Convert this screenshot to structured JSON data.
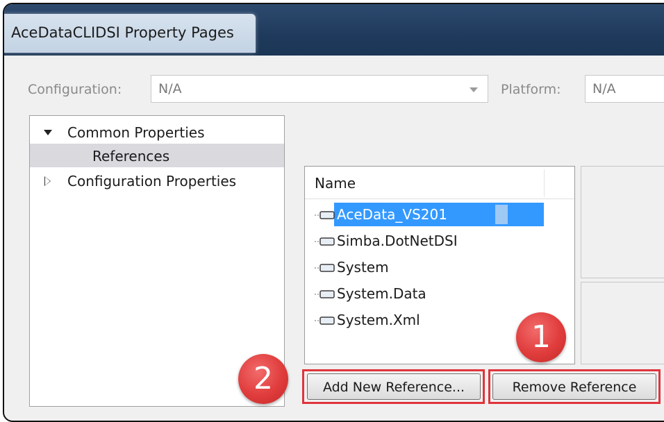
{
  "window": {
    "title": "AceDataCLIDSI Property Pages"
  },
  "config_bar": {
    "configuration_label": "Configuration:",
    "configuration_value": "N/A",
    "platform_label": "Platform:",
    "platform_value": "N/A"
  },
  "tree": {
    "items": [
      {
        "label": "Common Properties",
        "expanded": true
      },
      {
        "label": "References",
        "selected": true
      },
      {
        "label": "Configuration Properties",
        "expanded": false
      }
    ]
  },
  "references": {
    "column_header": "Name",
    "rows": [
      {
        "name": "AceData_VS201",
        "selected": true
      },
      {
        "name": "Simba.DotNetDSI"
      },
      {
        "name": "System"
      },
      {
        "name": "System.Data"
      },
      {
        "name": "System.Xml"
      }
    ]
  },
  "buttons": {
    "add_new_reference": "Add New Reference...",
    "remove_reference": "Remove Reference"
  },
  "annotations": {
    "badge_1": "1",
    "badge_2": "2",
    "highlight_color": "#e0343c"
  },
  "icons": {
    "reference_icon": "assembly-reference-icon",
    "expanded": "triangle-down-icon",
    "collapsed": "triangle-right-icon"
  }
}
